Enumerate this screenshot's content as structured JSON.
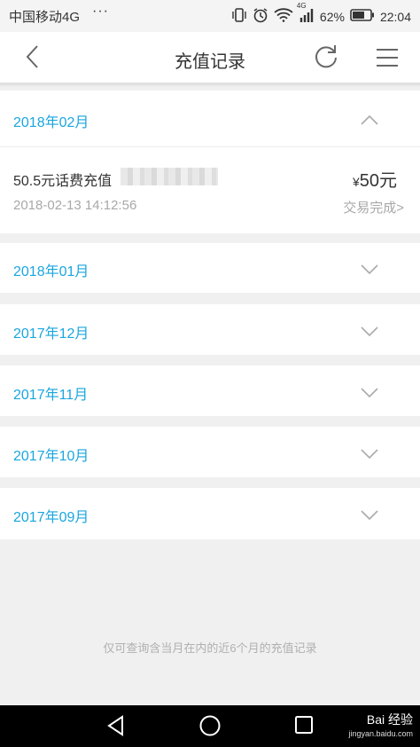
{
  "status_bar": {
    "carrier": "中国移动4G",
    "dots": "···",
    "network": "4G",
    "battery": "62%",
    "time": "22:04"
  },
  "header": {
    "title": "充值记录",
    "back_icon": "chevron-left-icon",
    "refresh_icon": "refresh-icon",
    "menu_icon": "hamburger-menu-icon"
  },
  "months": [
    {
      "label": "2018年02月",
      "expanded": true
    },
    {
      "label": "2018年01月",
      "expanded": false
    },
    {
      "label": "2017年12月",
      "expanded": false
    },
    {
      "label": "2017年11月",
      "expanded": false
    },
    {
      "label": "2017年10月",
      "expanded": false
    },
    {
      "label": "2017年09月",
      "expanded": false
    }
  ],
  "record": {
    "name": "50.5元话费充值",
    "datetime": "2018-02-13 14:12:56",
    "currency": "¥",
    "amount": "50元",
    "status": "交易完成>"
  },
  "footnote": "仅可查询含当月在内的近6个月的充值记录",
  "watermark": {
    "brand": "Bai 经验",
    "url": "jingyan.baidu.com"
  },
  "colors": {
    "accent": "#1aa6de",
    "text": "#333333",
    "muted": "#a8a8a8",
    "background": "#f0f0f0"
  }
}
